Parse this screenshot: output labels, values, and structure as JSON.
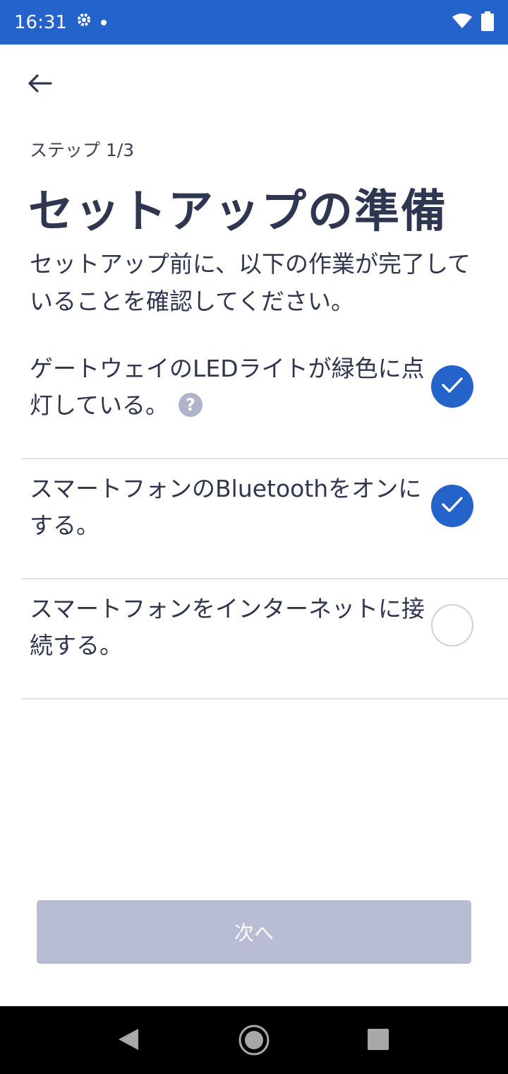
{
  "status_bar": {
    "time": "16:31",
    "icons": [
      "settings-icon",
      "notification-dot-icon",
      "wifi-icon",
      "battery-icon"
    ],
    "background": "#2463c9"
  },
  "header": {
    "back_icon": "arrow-left-icon",
    "step_label": "ステップ 1/3",
    "title": "セットアップの準備",
    "description": "セットアップ前に、以下の作業が完了していることを確認してください。"
  },
  "checklist": {
    "items": [
      {
        "label": "ゲートウェイのLEDライトが緑色に点灯している。",
        "checked": true,
        "has_help": true,
        "help_symbol": "?"
      },
      {
        "label": "スマートフォンのBluetoothをオンにする。",
        "checked": true,
        "has_help": false
      },
      {
        "label": "スマートフォンをインターネットに接続する。",
        "checked": false,
        "has_help": false
      }
    ]
  },
  "footer": {
    "next_label": "次へ",
    "next_enabled": false
  },
  "nav_bar": {
    "icons": [
      "back-triangle-icon",
      "home-circle-icon",
      "recents-square-icon"
    ]
  },
  "colors": {
    "accent": "#2463c9",
    "text": "#2f3650",
    "disabled_button": "#b8bdd4",
    "divider": "#e3e3e6"
  }
}
